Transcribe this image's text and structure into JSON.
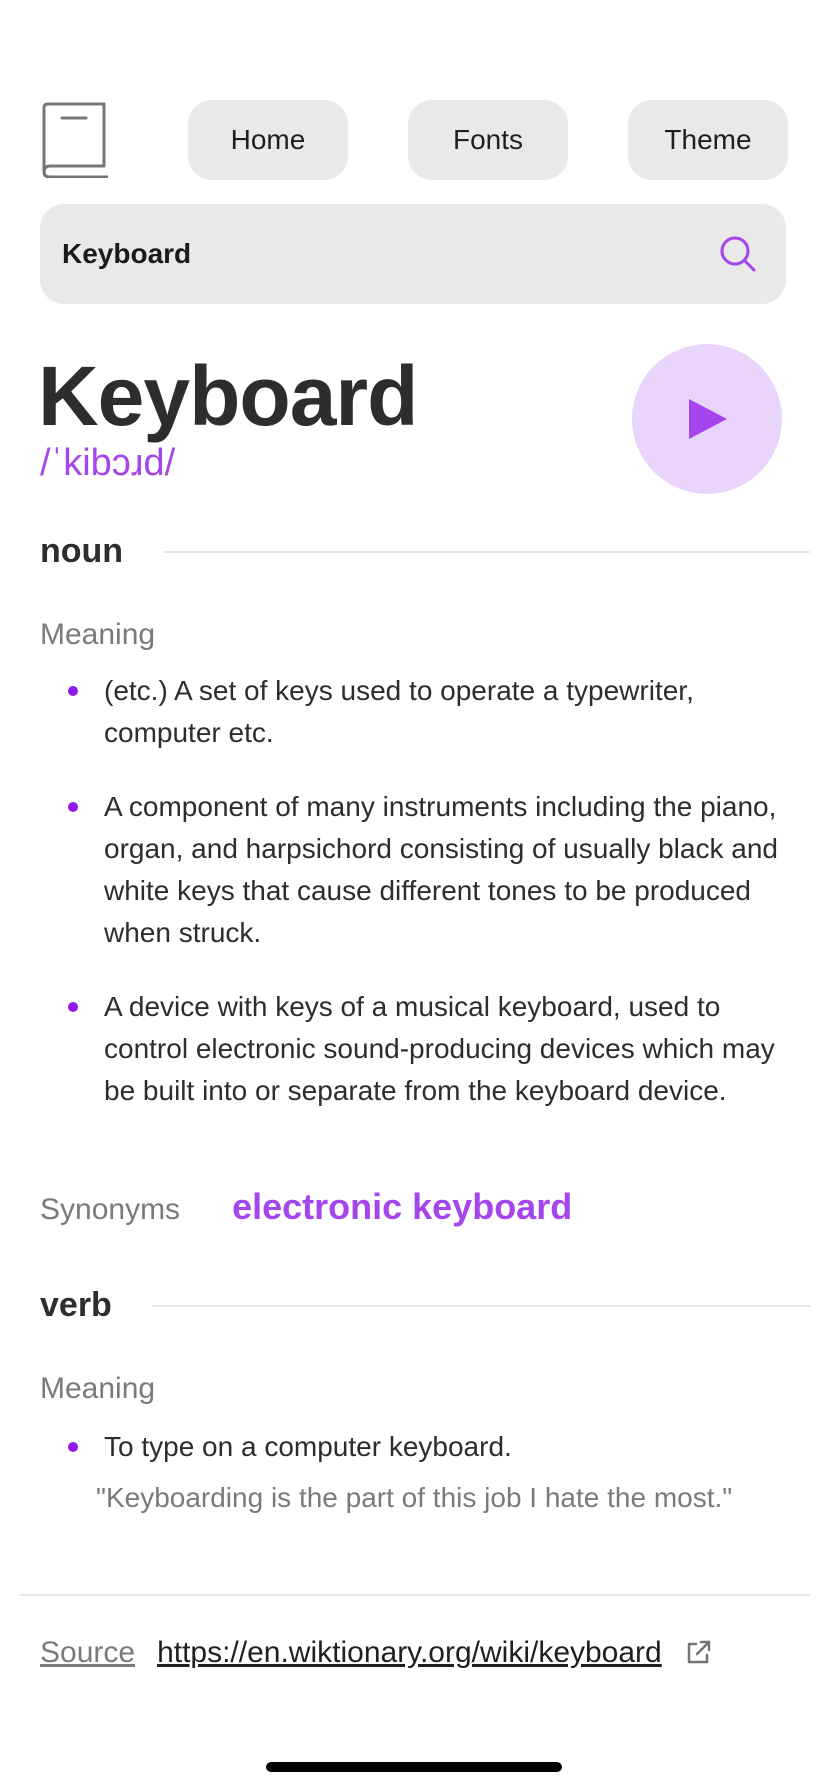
{
  "header": {
    "logo_icon": "book-icon",
    "nav": [
      {
        "label": "Home"
      },
      {
        "label": "Fonts"
      },
      {
        "label": "Theme"
      }
    ]
  },
  "search": {
    "value": "Keyboard",
    "icon": "search-icon"
  },
  "entry": {
    "word": "Keyboard",
    "phonetic": "/ˈkibɔɹd/",
    "play_icon": "play-icon",
    "noun": {
      "label": "noun",
      "meaning_label": "Meaning",
      "definitions": [
        "(etc.) A set of keys used to operate a typewriter, computer etc.",
        "A component of many instruments including the piano, organ, and harpsichord consisting of usually black and white keys that cause different tones to be produced when struck.",
        "A device with keys of a musical keyboard, used to control electronic sound-producing devices which may be built into or separate from the keyboard device."
      ],
      "synonyms_label": "Synonyms",
      "synonyms": [
        "electronic keyboard"
      ]
    },
    "verb": {
      "label": "verb",
      "meaning_label": "Meaning",
      "definitions": [
        "To type on a computer keyboard."
      ],
      "example": "\"Keyboarding is the part of this job I hate the most.\""
    }
  },
  "source": {
    "label": "Source",
    "url": "https://en.wiktionary.org/wiki/keyboard",
    "icon": "external-link-icon"
  },
  "colors": {
    "accent": "#a445ed",
    "accent_light": "#e9d4fb",
    "surface": "#e9e9e9",
    "text": "#2d2d2d",
    "muted": "#7a7a7a"
  }
}
